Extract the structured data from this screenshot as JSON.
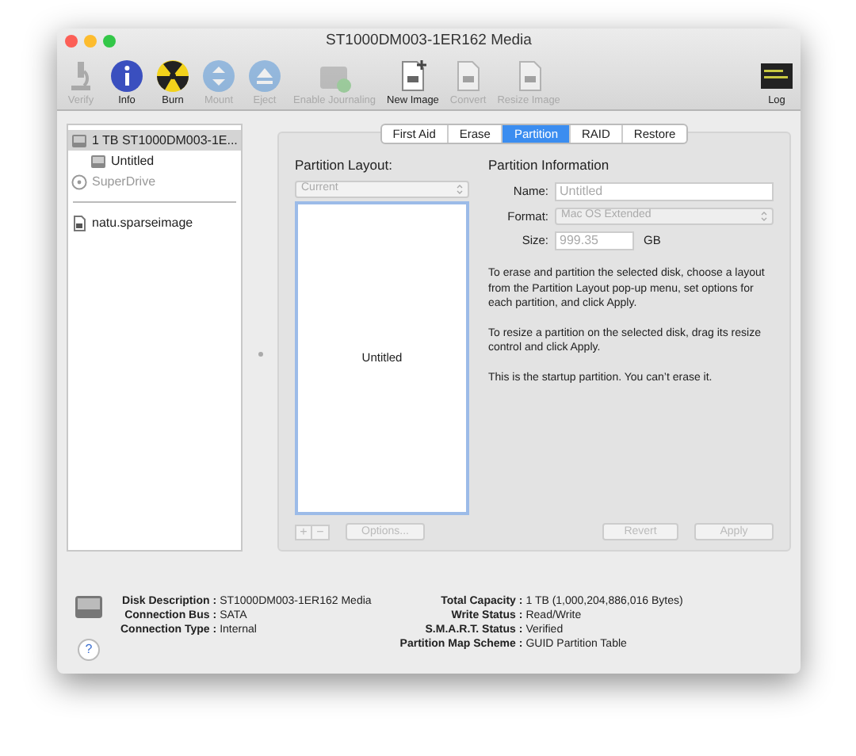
{
  "window": {
    "title": "ST1000DM003-1ER162 Media"
  },
  "toolbar": [
    {
      "kind": "verify",
      "label": "Verify",
      "disabled": true
    },
    {
      "kind": "info",
      "label": "Info",
      "disabled": false
    },
    {
      "kind": "burn",
      "label": "Burn",
      "disabled": false
    },
    {
      "kind": "mount",
      "label": "Mount",
      "disabled": true
    },
    {
      "kind": "eject",
      "label": "Eject",
      "disabled": true
    },
    {
      "kind": "journal",
      "label": "Enable Journaling",
      "disabled": true
    },
    {
      "kind": "newimage",
      "label": "New Image",
      "disabled": false
    },
    {
      "kind": "convert",
      "label": "Convert",
      "disabled": true
    },
    {
      "kind": "resize",
      "label": "Resize Image",
      "disabled": true
    },
    {
      "kind": "log",
      "label": "Log",
      "disabled": false
    }
  ],
  "sidebar": {
    "groups": [
      [
        {
          "kind": "disk",
          "label": "1 TB ST1000DM003-1E...",
          "selected": true,
          "disabled": false,
          "children": [
            {
              "kind": "disk",
              "label": "Untitled",
              "selected": false,
              "disabled": false
            }
          ]
        },
        {
          "kind": "optical",
          "label": "SuperDrive",
          "selected": false,
          "disabled": true
        }
      ],
      [
        {
          "kind": "image",
          "label": "natu.sparseimage",
          "selected": false,
          "disabled": false
        }
      ]
    ]
  },
  "tabs": [
    {
      "label": "First Aid",
      "selected": false
    },
    {
      "label": "Erase",
      "selected": false
    },
    {
      "label": "Partition",
      "selected": true
    },
    {
      "label": "RAID",
      "selected": false
    },
    {
      "label": "Restore",
      "selected": false
    }
  ],
  "partition": {
    "layout_title": "Partition Layout:",
    "layout_select": "Current",
    "partitions": [
      "Untitled"
    ],
    "add": "+",
    "remove": "−",
    "options": "Options...",
    "info_title": "Partition Information",
    "name_label": "Name:",
    "name_value": "Untitled",
    "format_label": "Format:",
    "format_value": "Mac OS Extended",
    "size_label": "Size:",
    "size_value": "999.35",
    "size_unit": "GB",
    "paragraphs": [
      "To erase and partition the selected disk, choose a layout from the Partition Layout pop-up menu, set options for each partition, and click Apply.",
      "To resize a partition on the selected disk, drag its resize control and click Apply.",
      "This is the startup partition. You can’t erase it."
    ],
    "revert": "Revert",
    "apply": "Apply"
  },
  "details": {
    "left": [
      {
        "label": "Disk Description",
        "value": "ST1000DM003-1ER162 Media"
      },
      {
        "label": "Connection Bus",
        "value": "SATA"
      },
      {
        "label": "Connection Type",
        "value": "Internal"
      }
    ],
    "right": [
      {
        "label": "Total Capacity",
        "value": "1 TB (1,000,204,886,016 Bytes)"
      },
      {
        "label": "Write Status",
        "value": "Read/Write"
      },
      {
        "label": "S.M.A.R.T. Status",
        "value": "Verified"
      },
      {
        "label": "Partition Map Scheme",
        "value": "GUID Partition Table"
      }
    ],
    "separator": ":",
    "help": "?"
  }
}
